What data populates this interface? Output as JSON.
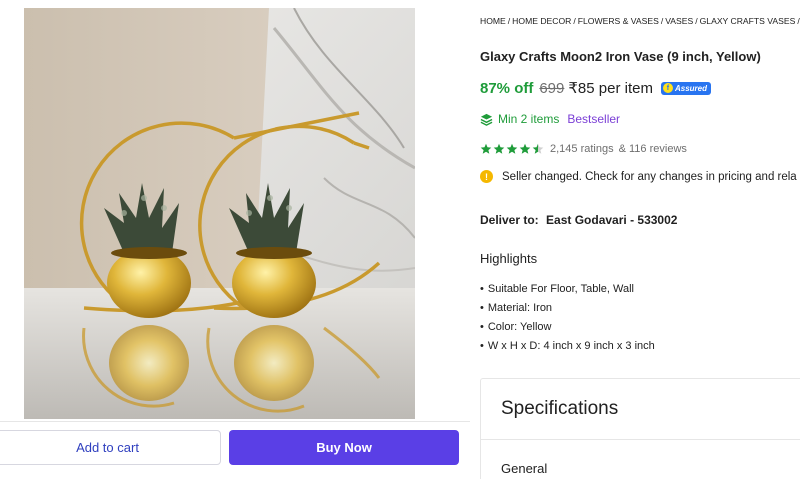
{
  "breadcrumb": [
    {
      "label": "HOME"
    },
    {
      "label": "HOME DECOR"
    },
    {
      "label": "FLOWERS & VASES"
    },
    {
      "label": "VASES"
    },
    {
      "label": "GLAXY CRAFTS VASES"
    }
  ],
  "breadcrumb_separator": "/",
  "product": {
    "title": "Glaxy Crafts Moon2 Iron Vase (9 inch, Yellow)",
    "discount": "87% off",
    "mrp": "699",
    "price": "₹85 per item",
    "assured_label": "Assured",
    "min_items": "Min 2 items",
    "badge": "Bestseller",
    "rating_value": 4.5,
    "rating_stars_max": 5,
    "ratings": "2,145 ratings",
    "reviews": "& 116 reviews",
    "notice": "Seller changed. Check for any changes in pricing and rela",
    "image_alt_icon": "vase-product-image"
  },
  "delivery": {
    "label": "Deliver to:",
    "location": "East Godavari - 533002"
  },
  "highlights": {
    "title": "Highlights",
    "items": [
      "Suitable For Floor, Table, Wall",
      "Material: Iron",
      "Color: Yellow",
      "W x H x D: 4 inch x 9 inch x 3 inch"
    ]
  },
  "specifications": {
    "title": "Specifications",
    "first_section": "General"
  },
  "actions": {
    "add_to_cart": "Add to cart",
    "buy_now": "Buy Now"
  },
  "colors": {
    "discount_green": "#1f9c3a",
    "buy_button": "#5a3fe6",
    "assured_blue": "#2874f0",
    "bestseller_purple": "#7b3fd6",
    "notice_yellow": "#f5b800"
  },
  "icons": {
    "assured": "flipkart-assured-icon",
    "min_items": "stack-icon",
    "star": "star-icon",
    "notice": "info-icon"
  }
}
